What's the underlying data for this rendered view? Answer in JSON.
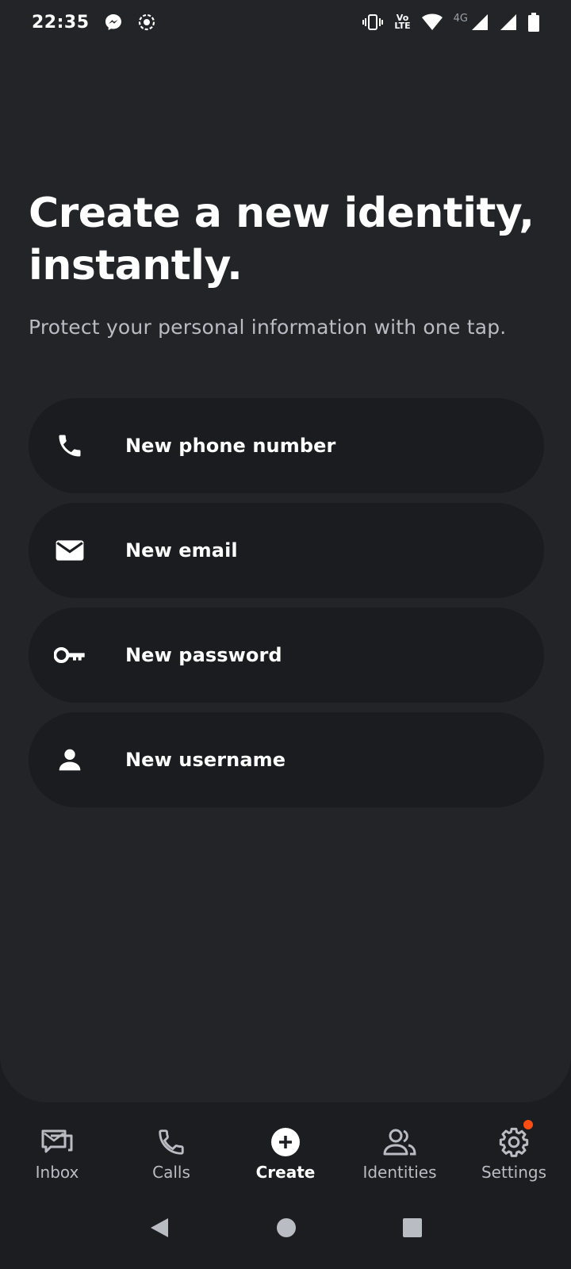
{
  "status_bar": {
    "time": "22:35",
    "notification_icons": [
      "messenger-icon",
      "screen-record-icon"
    ],
    "system_icons": [
      "vibrate-icon",
      "volte-icon",
      "wifi-icon",
      "signal-icon",
      "signal-icon",
      "battery-icon"
    ],
    "volte_top": "Vo",
    "volte_bottom": "LTE",
    "network": "4G"
  },
  "hero": {
    "headline": "Create a new identity, instantly.",
    "subtitle": "Protect your personal information with one tap."
  },
  "options": [
    {
      "icon": "phone-icon",
      "label": "New phone number"
    },
    {
      "icon": "mail-icon",
      "label": "New email"
    },
    {
      "icon": "key-icon",
      "label": "New password"
    },
    {
      "icon": "person-icon",
      "label": "New username"
    }
  ],
  "bottom_nav": [
    {
      "icon": "inbox-icon",
      "label": "Inbox",
      "active": false
    },
    {
      "icon": "phone-icon",
      "label": "Calls",
      "active": false
    },
    {
      "icon": "plus-circle-icon",
      "label": "Create",
      "active": true
    },
    {
      "icon": "people-icon",
      "label": "Identities",
      "active": false
    },
    {
      "icon": "gear-icon",
      "label": "Settings",
      "active": false,
      "badge": true
    }
  ],
  "colors": {
    "background": "#1b1d21",
    "card": "#222428",
    "option_bg": "#1a1c20",
    "muted_text": "#b9bcc2",
    "badge": "#ff4d12"
  }
}
